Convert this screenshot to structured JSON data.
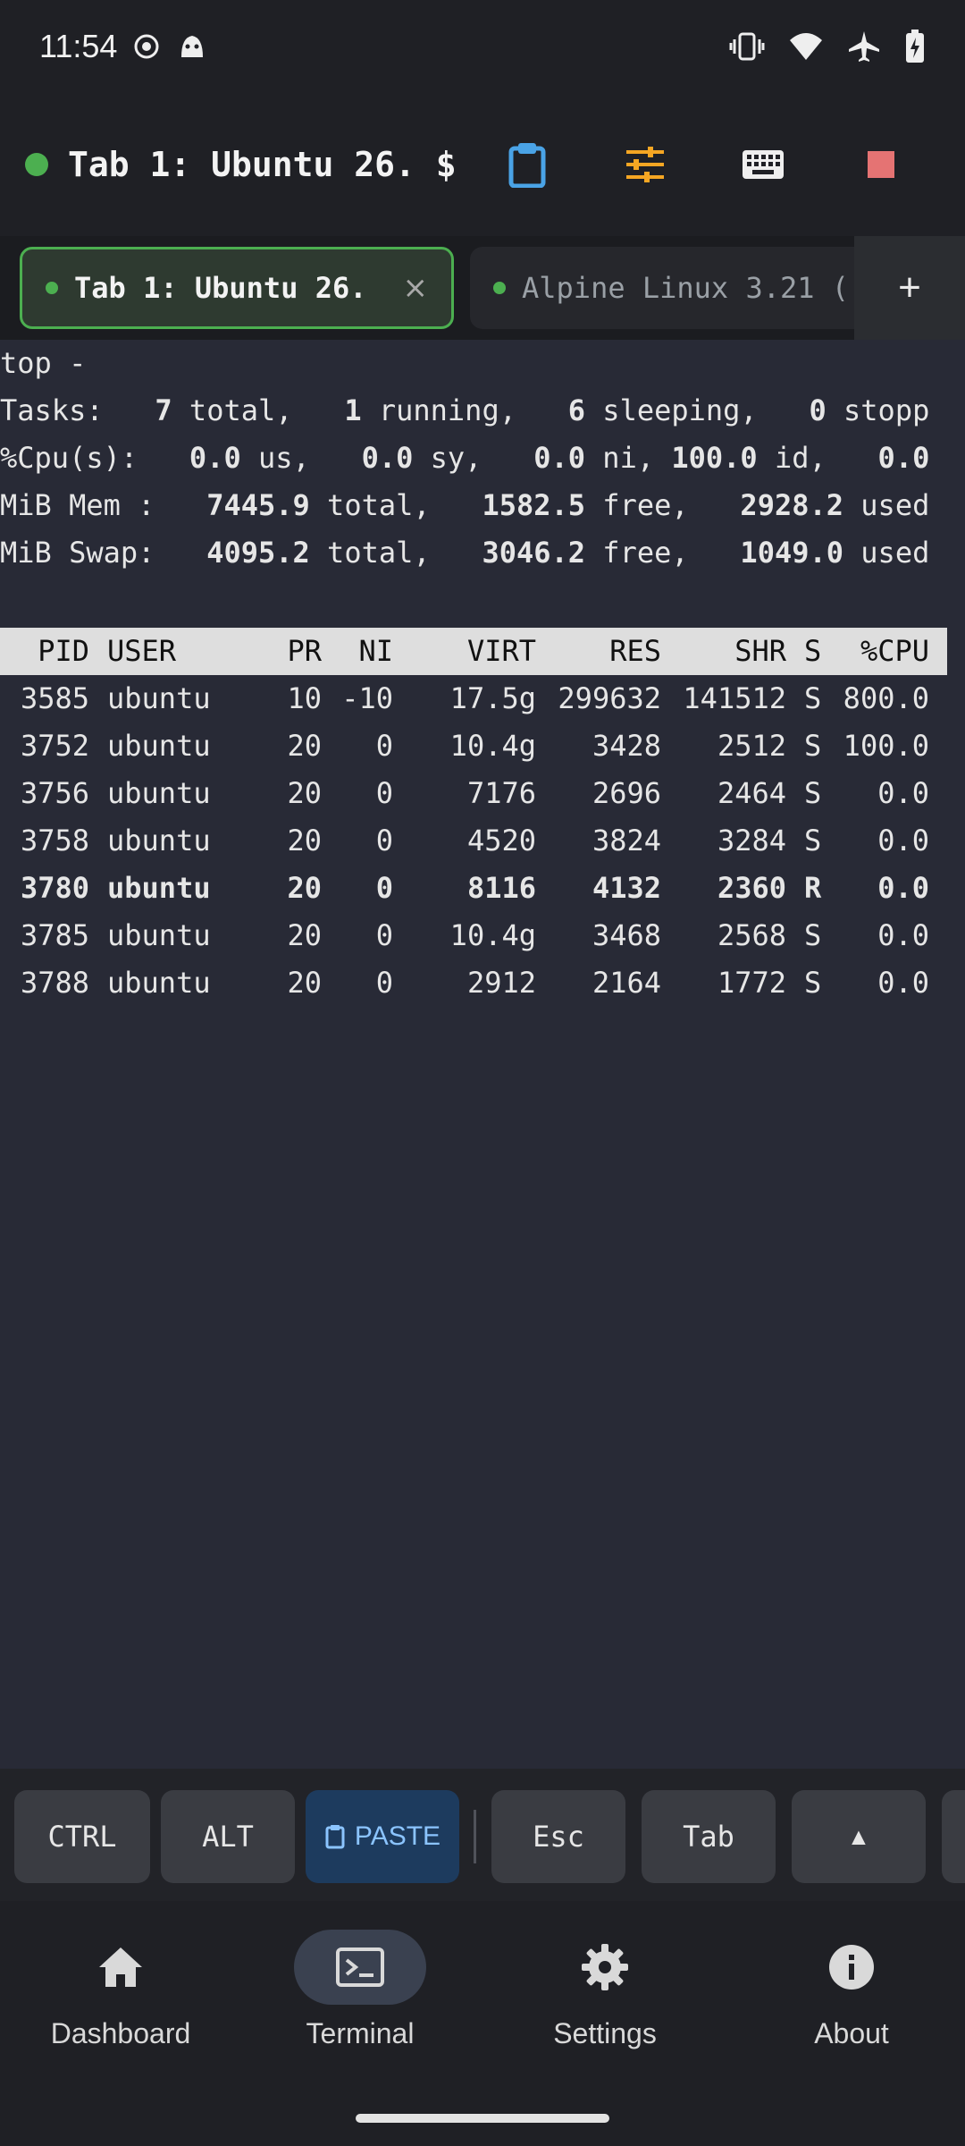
{
  "status_bar": {
    "time": "11:54"
  },
  "toolbar": {
    "title": "Tab 1: Ubuntu 26. $",
    "icons": [
      "clipboard-icon",
      "sliders-icon",
      "keyboard-icon",
      "stop-icon"
    ],
    "colors": {
      "status_dot": "#4caf50",
      "clipboard": "#4aa3e6",
      "sliders": "#f5a623",
      "stop": "#e57373"
    }
  },
  "tabs": {
    "active": {
      "label": "Tab 1: Ubuntu 26.",
      "close": "×"
    },
    "inactive": {
      "label": "Alpine Linux 3.21 ("
    },
    "add": "+"
  },
  "terminal": {
    "line0": "top -",
    "line1": "Tasks:   7 total,   1 running,   6 sleeping,   0 stopp",
    "line2": "%Cpu(s):   0.0 us,   0.0 sy,   0.0 ni, 100.0 id,   0.0",
    "line3": "MiB Mem :   7445.9 total,   1582.5 free,   2928.2 used",
    "line4": "MiB Swap:   4095.2 total,   3046.2 free,   1049.0 used",
    "columns": [
      "PID",
      "USER",
      "PR",
      "NI",
      "VIRT",
      "RES",
      "SHR",
      "S",
      "%CPU"
    ],
    "rows": [
      {
        "pid": "3585",
        "user": "ubuntu",
        "pr": "10",
        "ni": "-10",
        "virt": "17.5g",
        "res": "299632",
        "shr": "141512",
        "s": "S",
        "cpu": "800.0"
      },
      {
        "pid": "3752",
        "user": "ubuntu",
        "pr": "20",
        "ni": "0",
        "virt": "10.4g",
        "res": "3428",
        "shr": "2512",
        "s": "S",
        "cpu": "100.0"
      },
      {
        "pid": "3756",
        "user": "ubuntu",
        "pr": "20",
        "ni": "0",
        "virt": "7176",
        "res": "2696",
        "shr": "2464",
        "s": "S",
        "cpu": "0.0"
      },
      {
        "pid": "3758",
        "user": "ubuntu",
        "pr": "20",
        "ni": "0",
        "virt": "4520",
        "res": "3824",
        "shr": "3284",
        "s": "S",
        "cpu": "0.0"
      },
      {
        "pid": "3780",
        "user": "ubuntu",
        "pr": "20",
        "ni": "0",
        "virt": "8116",
        "res": "4132",
        "shr": "2360",
        "s": "R",
        "cpu": "0.0"
      },
      {
        "pid": "3785",
        "user": "ubuntu",
        "pr": "20",
        "ni": "0",
        "virt": "10.4g",
        "res": "3468",
        "shr": "2568",
        "s": "S",
        "cpu": "0.0"
      },
      {
        "pid": "3788",
        "user": "ubuntu",
        "pr": "20",
        "ni": "0",
        "virt": "2912",
        "res": "2164",
        "shr": "1772",
        "s": "S",
        "cpu": "0.0"
      }
    ]
  },
  "extra_keys": {
    "ctrl": "CTRL",
    "alt": "ALT",
    "paste": "PASTE",
    "esc": "Esc",
    "tab": "Tab",
    "up": "▲"
  },
  "bottom_nav": {
    "items": [
      {
        "label": "Dashboard",
        "icon": "home-icon"
      },
      {
        "label": "Terminal",
        "icon": "terminal-icon",
        "active": true
      },
      {
        "label": "Settings",
        "icon": "gear-icon"
      },
      {
        "label": "About",
        "icon": "info-icon"
      }
    ]
  }
}
